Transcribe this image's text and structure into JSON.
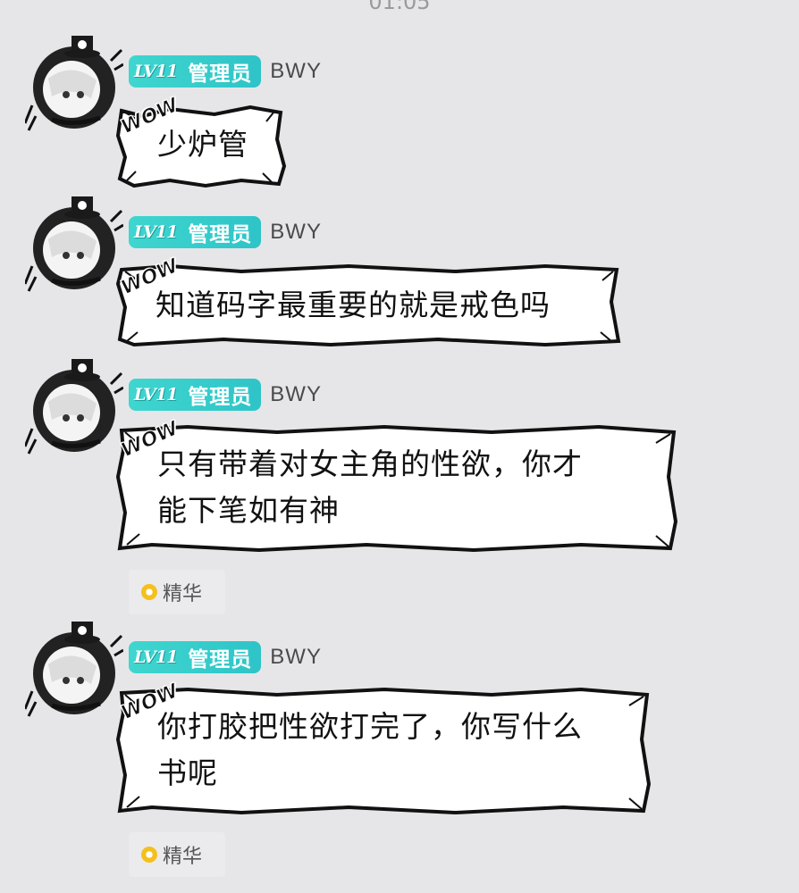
{
  "header": {
    "timestamp": "01:05"
  },
  "messages": [
    {
      "level": "LV11",
      "role": "管理员",
      "username": "BWY",
      "text": "少炉管",
      "lines": [
        "少炉管"
      ],
      "sticker": "WOW",
      "essence": false
    },
    {
      "level": "LV11",
      "role": "管理员",
      "username": "BWY",
      "text": "知道码字最重要的就是戒色吗",
      "lines": [
        "知道码字最重要的就是戒色吗"
      ],
      "sticker": "WOW",
      "essence": false
    },
    {
      "level": "LV11",
      "role": "管理员",
      "username": "BWY",
      "text": "只有带着对女主角的性欲，你才能下笔如有神",
      "lines": [
        "只有带着对女主角的性欲，你才",
        "能下笔如有神"
      ],
      "sticker": "WOW",
      "essence": true
    },
    {
      "level": "LV11",
      "role": "管理员",
      "username": "BWY",
      "text": "你打胶把性欲打完了，你写什么书呢",
      "lines": [
        "你打胶把性欲打完了，你写什么",
        "书呢"
      ],
      "sticker": "WOW",
      "essence": true
    }
  ],
  "essence_label": "精华",
  "icons": {
    "avatar": "anime-girl-top-hat-avatar",
    "essence": "essence-coin-icon"
  },
  "colors": {
    "background": "#e6e6e8",
    "level_tag": "#3fd6cf",
    "bubble_border": "#111111",
    "essence_coin": "#f4c01e"
  }
}
